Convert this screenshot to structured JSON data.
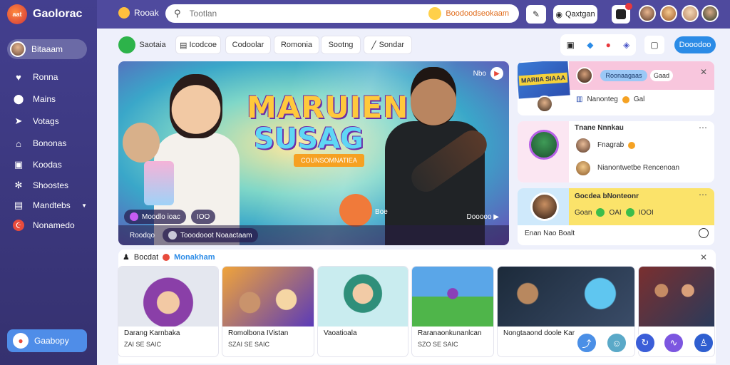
{
  "app": {
    "logo_badge": "aat",
    "logo_text": "Gaolorac"
  },
  "sidebar": {
    "user_name": "Bitaaam",
    "items": [
      {
        "label": "Ronna",
        "icon": "heart-icon"
      },
      {
        "label": "Mains",
        "icon": "pin-icon"
      },
      {
        "label": "Votags",
        "icon": "send-icon"
      },
      {
        "label": "Bononas",
        "icon": "home-icon"
      },
      {
        "label": "Koodas",
        "icon": "image-icon"
      },
      {
        "label": "Shoostes",
        "icon": "gear-icon"
      },
      {
        "label": "Mandtebs",
        "icon": "folder-icon"
      },
      {
        "label": "Nonamedo",
        "icon": "spiral-icon"
      }
    ],
    "bottom_button": "Gaabopy"
  },
  "topbar": {
    "brand": "Rooak",
    "search_placeholder": "Tootlan",
    "search_chip": "Boodoodseokaam",
    "pill_label": "Qaxtgan"
  },
  "subnav": {
    "items": [
      "Saotaia",
      "Icodcoe",
      "Codoolar",
      "Romonia",
      "Sootng",
      "Sondar"
    ],
    "action_button": "Dooodoo"
  },
  "hero": {
    "title_line1": "MARUIEN",
    "title_line2": "SUSAG",
    "ribbon": "COUNSOMNATIEA",
    "chip1": "Moodlo ioac",
    "chip2": "IOO",
    "bottom_label": "Roodqo",
    "bottom_chip": "Tooodooot  Noaactaam",
    "tag": "Boe",
    "next": "Dooooo",
    "corner_text": "Nbo"
  },
  "cards": {
    "card1": {
      "image_label": "MARIIA SIAAA",
      "pill_blue": "Roonaagaas",
      "pill_white": "Gaad",
      "row": "Nanonteg",
      "row_suffix": "Gal"
    },
    "card2": {
      "title": "Tnane Nnnkau",
      "row1": "Fnagrab",
      "row2": "Nianontwetbe Rencenoan"
    },
    "card3": {
      "title": "Gocdea bNonteonr",
      "row1_a": "Goan",
      "row1_b": "OAI",
      "row1_c": "IOOI",
      "footer": "Enan Nao Boalt"
    }
  },
  "recommendations": {
    "title": "Bocdat",
    "accent": "Monakham",
    "tiles": [
      {
        "title": "Darang Karnbaka",
        "meta": "ZAI  SE  SAIC"
      },
      {
        "title": "Romolbona IVistan",
        "meta": "SZAI  SE  SAIC"
      },
      {
        "title": "Vaoatioala",
        "meta": ""
      },
      {
        "title": "Raranaonkunanlcan",
        "meta": "SZO  SE  SAIC"
      },
      {
        "title": "Nongtaaond doole Kar",
        "meta": ""
      }
    ]
  }
}
